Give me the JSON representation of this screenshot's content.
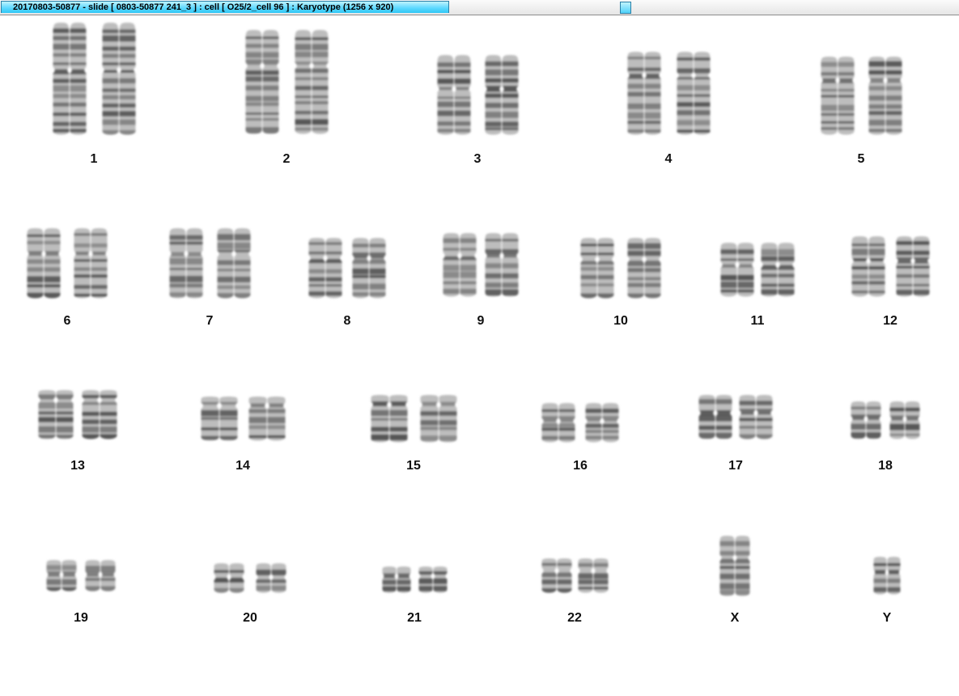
{
  "window": {
    "title": "20170803-50877 - slide [ 0803-50877 241_3 ] : cell [ O25/2_cell 96 ] : Karyotype  (1256 x 920)"
  },
  "colors": {
    "title_tab": "#5fd9ff",
    "chromatin_light": "#bdbdbd",
    "chromatin_dark": "#3c3c3c"
  },
  "karyotype": {
    "pairs": [
      {
        "label": "1"
      },
      {
        "label": "2"
      },
      {
        "label": "3"
      },
      {
        "label": "4"
      },
      {
        "label": "5"
      },
      {
        "label": "6"
      },
      {
        "label": "7"
      },
      {
        "label": "8"
      },
      {
        "label": "9"
      },
      {
        "label": "10"
      },
      {
        "label": "11"
      },
      {
        "label": "12"
      },
      {
        "label": "13"
      },
      {
        "label": "14"
      },
      {
        "label": "15"
      },
      {
        "label": "16"
      },
      {
        "label": "17"
      },
      {
        "label": "18"
      },
      {
        "label": "19"
      },
      {
        "label": "20"
      },
      {
        "label": "21"
      },
      {
        "label": "22"
      },
      {
        "label": "X"
      },
      {
        "label": "Y"
      }
    ]
  }
}
